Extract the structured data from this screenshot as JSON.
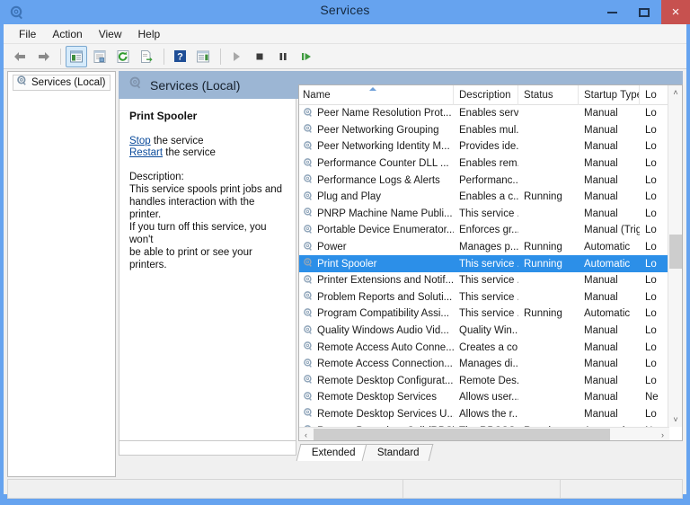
{
  "window": {
    "title": "Services",
    "title_icon": "services-gear-icon",
    "minimize_label": "–",
    "maximize_label": "□",
    "close_label": "×",
    "titlebar_color": "#66a3ef",
    "close_color": "#c7514f"
  },
  "menubar": {
    "items": [
      {
        "label": "File"
      },
      {
        "label": "Action"
      },
      {
        "label": "View"
      },
      {
        "label": "Help"
      }
    ]
  },
  "toolbar": {
    "buttons": [
      {
        "name": "back-button",
        "icon": "arrow-left-icon",
        "pressed": false
      },
      {
        "name": "forward-button",
        "icon": "arrow-right-icon",
        "pressed": false
      },
      {
        "name": "show-hide-console-tree-button",
        "icon": "console-tree-icon",
        "pressed": true
      },
      {
        "name": "properties-button",
        "icon": "properties-icon",
        "pressed": false
      },
      {
        "name": "refresh-button",
        "icon": "refresh-icon",
        "pressed": false
      },
      {
        "name": "export-list-button",
        "icon": "export-list-icon",
        "pressed": false
      },
      {
        "name": "help-button",
        "icon": "help-question-icon",
        "pressed": false
      },
      {
        "name": "show-action-pane-button",
        "icon": "action-pane-icon",
        "pressed": false
      },
      {
        "name": "start-service-button",
        "icon": "play-icon",
        "pressed": false
      },
      {
        "name": "stop-service-button",
        "icon": "stop-square-icon",
        "pressed": false
      },
      {
        "name": "pause-service-button",
        "icon": "pause-icon",
        "pressed": false
      },
      {
        "name": "restart-service-button",
        "icon": "restart-play-icon",
        "pressed": false
      }
    ]
  },
  "tree": {
    "root_label": "Services (Local)",
    "root_icon": "services-gear-icon"
  },
  "pane": {
    "header_title": "Services (Local)",
    "header_icon": "services-gear-icon",
    "header_color": "#9cb6d4"
  },
  "detail": {
    "service_name": "Print Spooler",
    "actions": [
      {
        "link": "Stop",
        "rest": " the service"
      },
      {
        "link": "Restart",
        "rest": " the service"
      }
    ],
    "description_label": "Description:",
    "description_lines": [
      "This service spools print jobs and",
      "handles interaction with the printer.",
      "If you turn off this service, you won't",
      "be able to print or see your printers."
    ]
  },
  "list": {
    "columns": [
      {
        "label": "Name",
        "sorted": "asc"
      },
      {
        "label": "Description"
      },
      {
        "label": "Status"
      },
      {
        "label": "Startup Type"
      },
      {
        "label": "Lo"
      }
    ],
    "row_icon": "service-gear-icon",
    "rows": [
      {
        "name": "Peer Name Resolution Prot...",
        "description": "Enables serv...",
        "status": "",
        "startup": "Manual",
        "logon": "Lo",
        "selected": false
      },
      {
        "name": "Peer Networking Grouping",
        "description": "Enables mul...",
        "status": "",
        "startup": "Manual",
        "logon": "Lo",
        "selected": false
      },
      {
        "name": "Peer Networking Identity M...",
        "description": "Provides ide...",
        "status": "",
        "startup": "Manual",
        "logon": "Lo",
        "selected": false
      },
      {
        "name": "Performance Counter DLL ...",
        "description": "Enables rem...",
        "status": "",
        "startup": "Manual",
        "logon": "Lo",
        "selected": false
      },
      {
        "name": "Performance Logs & Alerts",
        "description": "Performanc...",
        "status": "",
        "startup": "Manual",
        "logon": "Lo",
        "selected": false
      },
      {
        "name": "Plug and Play",
        "description": "Enables a c...",
        "status": "Running",
        "startup": "Manual",
        "logon": "Lo",
        "selected": false
      },
      {
        "name": "PNRP Machine Name Publi...",
        "description": "This service ...",
        "status": "",
        "startup": "Manual",
        "logon": "Lo",
        "selected": false
      },
      {
        "name": "Portable Device Enumerator...",
        "description": "Enforces gr...",
        "status": "",
        "startup": "Manual (Trig...",
        "logon": "Lo",
        "selected": false
      },
      {
        "name": "Power",
        "description": "Manages p...",
        "status": "Running",
        "startup": "Automatic",
        "logon": "Lo",
        "selected": false
      },
      {
        "name": "Print Spooler",
        "description": "This service ...",
        "status": "Running",
        "startup": "Automatic",
        "logon": "Lo",
        "selected": true
      },
      {
        "name": "Printer Extensions and Notif...",
        "description": "This service ...",
        "status": "",
        "startup": "Manual",
        "logon": "Lo",
        "selected": false
      },
      {
        "name": "Problem Reports and Soluti...",
        "description": "This service ...",
        "status": "",
        "startup": "Manual",
        "logon": "Lo",
        "selected": false
      },
      {
        "name": "Program Compatibility Assi...",
        "description": "This service ...",
        "status": "Running",
        "startup": "Automatic",
        "logon": "Lo",
        "selected": false
      },
      {
        "name": "Quality Windows Audio Vid...",
        "description": "Quality Win...",
        "status": "",
        "startup": "Manual",
        "logon": "Lo",
        "selected": false
      },
      {
        "name": "Remote Access Auto Conne...",
        "description": "Creates a co...",
        "status": "",
        "startup": "Manual",
        "logon": "Lo",
        "selected": false
      },
      {
        "name": "Remote Access Connection...",
        "description": "Manages di...",
        "status": "",
        "startup": "Manual",
        "logon": "Lo",
        "selected": false
      },
      {
        "name": "Remote Desktop Configurat...",
        "description": "Remote Des...",
        "status": "",
        "startup": "Manual",
        "logon": "Lo",
        "selected": false
      },
      {
        "name": "Remote Desktop Services",
        "description": "Allows user...",
        "status": "",
        "startup": "Manual",
        "logon": "Ne",
        "selected": false
      },
      {
        "name": "Remote Desktop Services U...",
        "description": "Allows the r...",
        "status": "",
        "startup": "Manual",
        "logon": "Lo",
        "selected": false
      },
      {
        "name": "Remote Procedure Call (RPC)",
        "description": "The RPCSS ...",
        "status": "Running",
        "startup": "Automatic",
        "logon": "Ne",
        "selected": false
      }
    ],
    "selection_color": "#2c8fe8"
  },
  "scrollbars": {
    "up_arrow": "˄",
    "down_arrow": "˅",
    "left_arrow": "‹",
    "right_arrow": "›"
  },
  "tabs": [
    {
      "label": "Extended",
      "active": true
    },
    {
      "label": "Standard",
      "active": false
    }
  ],
  "statusbar": {
    "panes": [
      "",
      "",
      ""
    ]
  }
}
